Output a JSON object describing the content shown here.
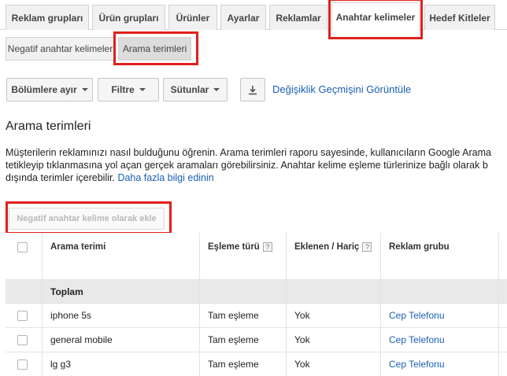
{
  "tabs": [
    {
      "label": "Reklam grupları"
    },
    {
      "label": "Ürün grupları"
    },
    {
      "label": "Ürünler"
    },
    {
      "label": "Ayarlar"
    },
    {
      "label": "Reklamlar"
    },
    {
      "label": "Anahtar kelimeler",
      "active": true
    },
    {
      "label": "Hedef Kitleler"
    }
  ],
  "subtabs": [
    {
      "label": "Negatif anahtar kelimeler"
    },
    {
      "label": "Arama terimleri",
      "active": true
    }
  ],
  "toolbar": {
    "segment_label": "Bölümlere ayır",
    "filter_label": "Filtre",
    "columns_label": "Sütunlar",
    "download_icon": "download-icon",
    "change_history_link": "Değişiklik Geçmişini Görüntüle"
  },
  "section": {
    "title": "Arama terimleri",
    "description_line1": "Müşterilerin reklamınızı nasıl bulduğunu öğrenin. Arama terimleri raporu sayesinde, kullanıcıların Google Arama",
    "description_line2": "tetikleyip tıklanmasına yol açan gerçek aramaları görebilirsiniz. Anahtar kelime eşleme türlerinize bağlı olarak b",
    "description_line3": "dışında terimler içerebilir.",
    "learn_more_link": "Daha fazla bilgi edinin"
  },
  "add_negative_button": "Negatif anahtar kelime olarak ekle",
  "table": {
    "headers": {
      "search_term": "Arama terimi",
      "match_type": "Eşleme türü",
      "added_excluded": "Eklenen / Hariç",
      "ad_group": "Reklam grubu",
      "help": "?"
    },
    "total_label": "Toplam",
    "rows": [
      {
        "term": "iphone 5s",
        "match": "Tam eşleme",
        "added": "Yok",
        "group": "Cep Telefonu"
      },
      {
        "term": "general mobile",
        "match": "Tam eşleme",
        "added": "Yok",
        "group": "Cep Telefonu"
      },
      {
        "term": "lg g3",
        "match": "Tam eşleme",
        "added": "Yok",
        "group": "Cep Telefonu"
      }
    ]
  },
  "colors": {
    "highlight": "#e0201b",
    "link": "#1a5fb4"
  }
}
